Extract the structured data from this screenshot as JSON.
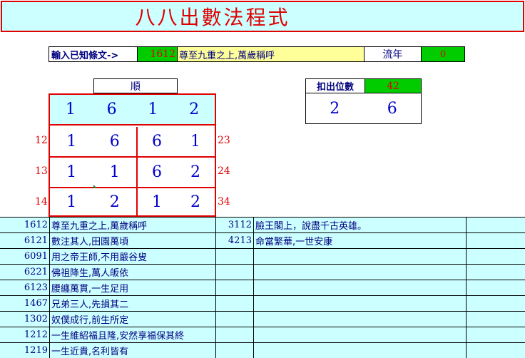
{
  "title": "八八出數法程式",
  "input": {
    "label": "輸入已知條文->",
    "code": "1612",
    "text": "尊至九重之上,萬歲稱呼",
    "year_label": "流年",
    "year_value": "0"
  },
  "order_label": "順",
  "grid": {
    "top": [
      "1",
      "6",
      "1",
      "2"
    ],
    "rows": [
      {
        "left_label": "12",
        "right_label": "23",
        "left": [
          "1",
          "6"
        ],
        "right": [
          "6",
          "1"
        ]
      },
      {
        "left_label": "13",
        "right_label": "24",
        "left": [
          "1",
          "1"
        ],
        "right": [
          "6",
          "2"
        ]
      },
      {
        "left_label": "14",
        "right_label": "34",
        "left": [
          "1",
          "2"
        ],
        "right": [
          "1",
          "2"
        ]
      }
    ]
  },
  "deduct": {
    "label": "扣出位數",
    "value": "42",
    "digits": [
      "2",
      "6"
    ]
  },
  "table": {
    "rows": [
      {
        "code": "1612",
        "text": "尊至九重之上,萬歲稱呼",
        "code2": "3112",
        "text2": "臉王閣上，說盡千古英雄。"
      },
      {
        "code": "6121",
        "text": "數注其人,田園萬頃",
        "code2": "4213",
        "text2": "命當繁華,一世安康"
      },
      {
        "code": "6091",
        "text": "用之帝王師,不用嚴谷叟",
        "code2": "",
        "text2": ""
      },
      {
        "code": "6221",
        "text": "佛祖降生,萬人皈依",
        "code2": "",
        "text2": ""
      },
      {
        "code": "6123",
        "text": "腰纏萬貫,一生足用",
        "code2": "",
        "text2": ""
      },
      {
        "code": "1467",
        "text": "兄弟三人,先損其二",
        "code2": "",
        "text2": ""
      },
      {
        "code": "1302",
        "text": "奴僕成行,前生所定",
        "code2": "",
        "text2": ""
      },
      {
        "code": "1212",
        "text": "一生維紹福且隆,安然享福保其終",
        "code2": "",
        "text2": ""
      },
      {
        "code": "1219",
        "text": "一生近貴,名利皆有",
        "code2": "",
        "text2": ""
      }
    ]
  }
}
